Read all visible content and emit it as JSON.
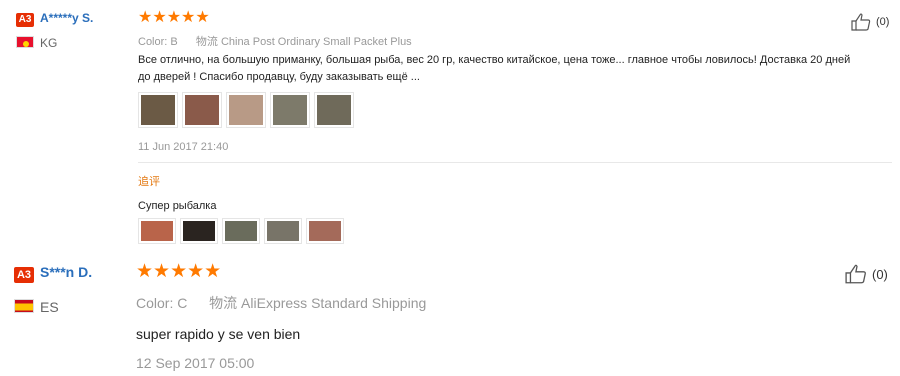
{
  "reviews": [
    {
      "level": "A3",
      "name": "A*****y S.",
      "country": "KG",
      "stars": "★★★★★",
      "color_label": "Color:",
      "color_value": "B",
      "shipping_label": "物流",
      "shipping_value": "China Post Ordinary Small Packet Plus",
      "text": "Все отлично, на большую приманку, большая рыба, вес 20 гр, качество китайское, цена тоже... главное чтобы ловилось! Доставка 20 дней до дверей ! Спасибо продавцу, буду заказывать ещё ...",
      "date": "11 Jun 2017 21:40",
      "likes": "(0)",
      "append_title": "追评",
      "append_text": "Супер рыбалка",
      "photo_colors": [
        "#6b5a45",
        "#8a5a4a",
        "#b89a86",
        "#7d7a6a",
        "#6f6a5a"
      ],
      "append_photo_colors": [
        "#b9644a",
        "#2a2420",
        "#6a6c5c",
        "#787468",
        "#a46a5a"
      ]
    },
    {
      "level": "A3",
      "name": "S***n D.",
      "country": "ES",
      "stars": "★★★★★",
      "color_label": "Color:",
      "color_value": "C",
      "shipping_label": "物流",
      "shipping_value": "AliExpress Standard Shipping",
      "text": "super rapido y se ven bien",
      "date": "12 Sep 2017 05:00",
      "likes": "(0)"
    }
  ]
}
